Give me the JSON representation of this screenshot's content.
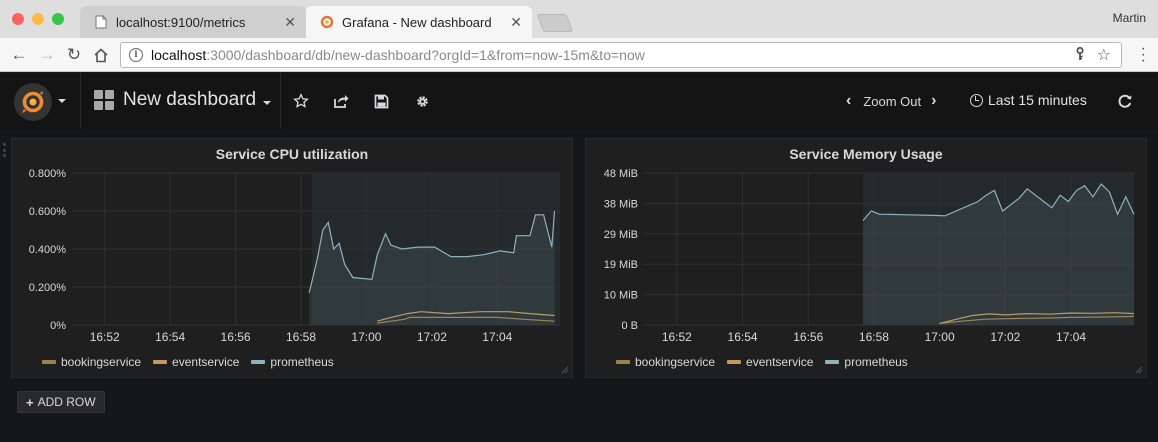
{
  "browser": {
    "tabs": [
      {
        "title": "localhost:9100/metrics",
        "active": false
      },
      {
        "title": "Grafana - New dashboard",
        "active": true
      }
    ],
    "profile_name": "Martin",
    "url_host": "localhost",
    "url_rest": ":3000/dashboard/db/new-dashboard?orgId=1&from=now-15m&to=now"
  },
  "grafana": {
    "dashboard_title": "New dashboard",
    "zoom_out_label": "Zoom Out",
    "time_range_label": "Last 15 minutes",
    "add_row_label": "ADD ROW",
    "colors": {
      "background": "#161719",
      "panel": "#1f1f20",
      "bookingservice": "#a07f4e",
      "eventservice": "#c19a5f",
      "prometheus": "#8eb3bf"
    }
  },
  "chart_data": [
    {
      "type": "line",
      "title": "Service CPU utilization",
      "x_ticks": [
        "16:52",
        "16:54",
        "16:56",
        "16:58",
        "17:00",
        "17:02",
        "17:04"
      ],
      "y_ticks": [
        "0%",
        "0.200%",
        "0.400%",
        "0.600%",
        "0.800%"
      ],
      "ylim": [
        0,
        0.8
      ],
      "grid": true,
      "legend": "bottom",
      "series": [
        {
          "name": "bookingservice",
          "color": "#a07f4e",
          "x": [
            "17:00:20",
            "17:00:45",
            "17:01:10",
            "17:01:20",
            "17:02:00",
            "17:03:00",
            "17:04:00",
            "17:04:50",
            "17:05:45"
          ],
          "y": [
            0.01,
            0.02,
            0.03,
            0.04,
            0.04,
            0.04,
            0.04,
            0.03,
            0.02
          ]
        },
        {
          "name": "eventservice",
          "color": "#c19a5f",
          "x": [
            "17:00:20",
            "17:00:45",
            "17:01:15",
            "17:01:40",
            "17:02:30",
            "17:03:30",
            "17:04:20",
            "17:05:00",
            "17:05:45"
          ],
          "y": [
            0.02,
            0.04,
            0.06,
            0.07,
            0.06,
            0.07,
            0.07,
            0.06,
            0.05
          ]
        },
        {
          "name": "prometheus",
          "color": "#8eb3bf",
          "x": [
            "16:58:15",
            "16:58:30",
            "16:58:40",
            "16:58:50",
            "16:59:00",
            "16:59:10",
            "16:59:20",
            "16:59:35",
            "17:00:10",
            "17:00:20",
            "17:00:35",
            "17:00:45",
            "17:01:05",
            "17:01:35",
            "17:02:05",
            "17:02:35",
            "17:03:05",
            "17:03:35",
            "17:04:05",
            "17:04:30",
            "17:04:35",
            "17:05:00",
            "17:05:10",
            "17:05:25",
            "17:05:40",
            "17:05:45"
          ],
          "y": [
            0.17,
            0.35,
            0.5,
            0.54,
            0.4,
            0.43,
            0.32,
            0.25,
            0.24,
            0.37,
            0.48,
            0.42,
            0.4,
            0.41,
            0.41,
            0.36,
            0.36,
            0.37,
            0.39,
            0.38,
            0.47,
            0.47,
            0.58,
            0.58,
            0.41,
            0.6
          ]
        }
      ]
    },
    {
      "type": "line",
      "title": "Service Memory Usage",
      "x_ticks": [
        "16:52",
        "16:54",
        "16:56",
        "16:58",
        "17:00",
        "17:02",
        "17:04"
      ],
      "y_ticks": [
        "0 B",
        "10 MiB",
        "19 MiB",
        "29 MiB",
        "38 MiB",
        "48 MiB"
      ],
      "ylim": [
        0,
        48
      ],
      "grid": true,
      "legend": "bottom",
      "series": [
        {
          "name": "bookingservice",
          "color": "#a07f4e",
          "x": [
            "17:00:00",
            "17:00:40",
            "17:01:20",
            "17:02:00",
            "17:02:40",
            "17:03:20",
            "17:04:00",
            "17:04:40",
            "17:05:20",
            "17:05:55"
          ],
          "y": [
            0.5,
            1.2,
            1.8,
            2.0,
            2.1,
            2.2,
            2.4,
            2.5,
            2.6,
            2.7
          ]
        },
        {
          "name": "eventservice",
          "color": "#c19a5f",
          "x": [
            "17:00:00",
            "17:00:30",
            "17:01:00",
            "17:01:30",
            "17:02:00",
            "17:02:40",
            "17:03:20",
            "17:04:00",
            "17:04:40",
            "17:05:20",
            "17:05:55"
          ],
          "y": [
            0.5,
            1.8,
            3.0,
            3.5,
            3.2,
            3.6,
            3.4,
            3.8,
            3.7,
            3.9,
            3.6
          ]
        },
        {
          "name": "prometheus",
          "color": "#8eb3bf",
          "x": [
            "16:57:40",
            "16:57:55",
            "16:58:10",
            "16:59:00",
            "16:59:50",
            "17:00:10",
            "17:00:30",
            "17:00:50",
            "17:01:10",
            "17:01:25",
            "17:01:40",
            "17:01:55",
            "17:02:10",
            "17:02:25",
            "17:02:40",
            "17:02:55",
            "17:03:10",
            "17:03:25",
            "17:03:40",
            "17:03:55",
            "17:04:10",
            "17:04:25",
            "17:04:40",
            "17:04:55",
            "17:05:10",
            "17:05:25",
            "17:05:40",
            "17:05:55"
          ],
          "y": [
            33,
            36,
            35,
            34.8,
            34.6,
            34.5,
            36,
            37.5,
            39,
            41,
            42.5,
            36,
            38,
            40,
            43,
            41,
            39,
            37,
            41,
            39,
            42.5,
            44,
            40.5,
            44.5,
            42,
            35,
            40.5,
            35
          ]
        }
      ]
    }
  ]
}
